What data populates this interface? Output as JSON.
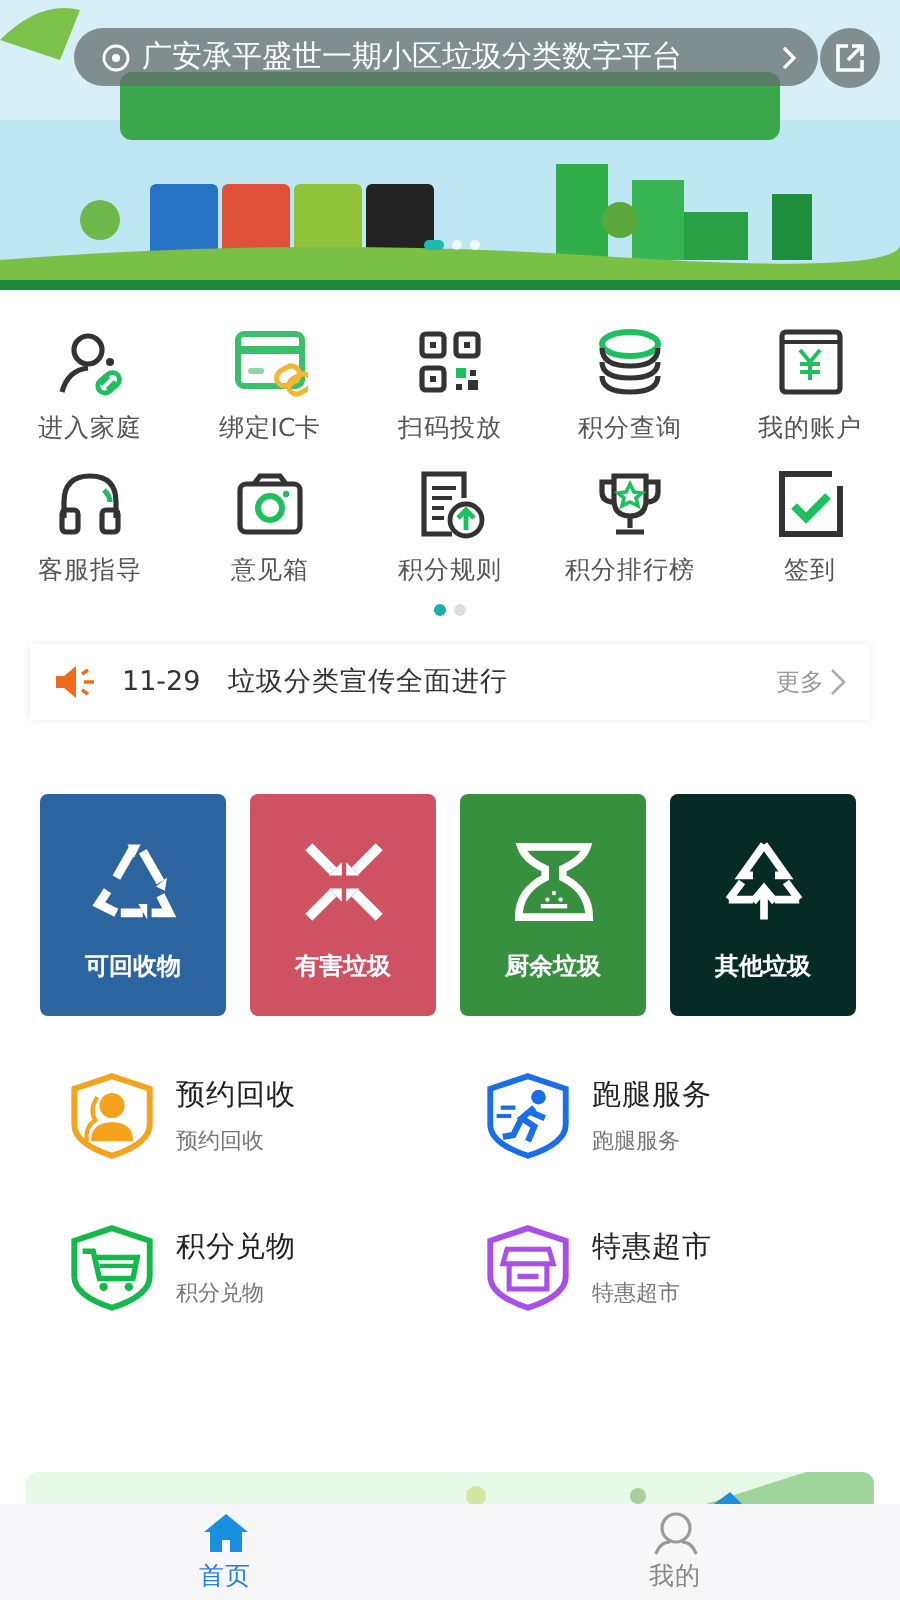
{
  "header": {
    "title": "广安承平盛世一期小区垃圾分类数字平台"
  },
  "banner": {
    "dots": [
      {
        "selected": true
      },
      {
        "selected": false
      },
      {
        "selected": false
      }
    ]
  },
  "shortcuts": [
    {
      "label": "进入家庭",
      "kind": "family"
    },
    {
      "label": "绑定IC卡",
      "kind": "card"
    },
    {
      "label": "扫码投放",
      "kind": "scan"
    },
    {
      "label": "积分查询",
      "kind": "coins"
    },
    {
      "label": "我的账户",
      "kind": "account"
    },
    {
      "label": "客服指导",
      "kind": "headset"
    },
    {
      "label": "意见箱",
      "kind": "camera"
    },
    {
      "label": "积分规则",
      "kind": "rules"
    },
    {
      "label": "积分排行榜",
      "kind": "trophy"
    },
    {
      "label": "签到",
      "kind": "checkin"
    }
  ],
  "shortcut_pages": [
    {
      "selected": true
    },
    {
      "selected": false
    }
  ],
  "notice": {
    "date": "11-29",
    "text": "垃圾分类宣传全面进行",
    "more": "更多"
  },
  "categories": [
    {
      "label": "可回收物",
      "kind": "recyclable",
      "color": "#2c64a0"
    },
    {
      "label": "有害垃圾",
      "kind": "hazardous",
      "color": "#cf5263"
    },
    {
      "label": "厨余垃圾",
      "kind": "kitchen",
      "color": "#37903e"
    },
    {
      "label": "其他垃圾",
      "kind": "other",
      "color": "#062a24"
    }
  ],
  "services": [
    {
      "title": "预约回收",
      "subtitle": "预约回收",
      "kind": "person",
      "color": "#f5a21c"
    },
    {
      "title": "跑腿服务",
      "subtitle": "跑腿服务",
      "kind": "runner",
      "color": "#1a6ee8"
    },
    {
      "title": "积分兑物",
      "subtitle": "积分兑物",
      "kind": "cart",
      "color": "#15b84a"
    },
    {
      "title": "特惠超市",
      "subtitle": "特惠超市",
      "kind": "shop",
      "color": "#a94ee8"
    }
  ],
  "tabbar": [
    {
      "label": "首页",
      "kind": "home",
      "selected": true
    },
    {
      "label": "我的",
      "kind": "user",
      "selected": false
    }
  ]
}
